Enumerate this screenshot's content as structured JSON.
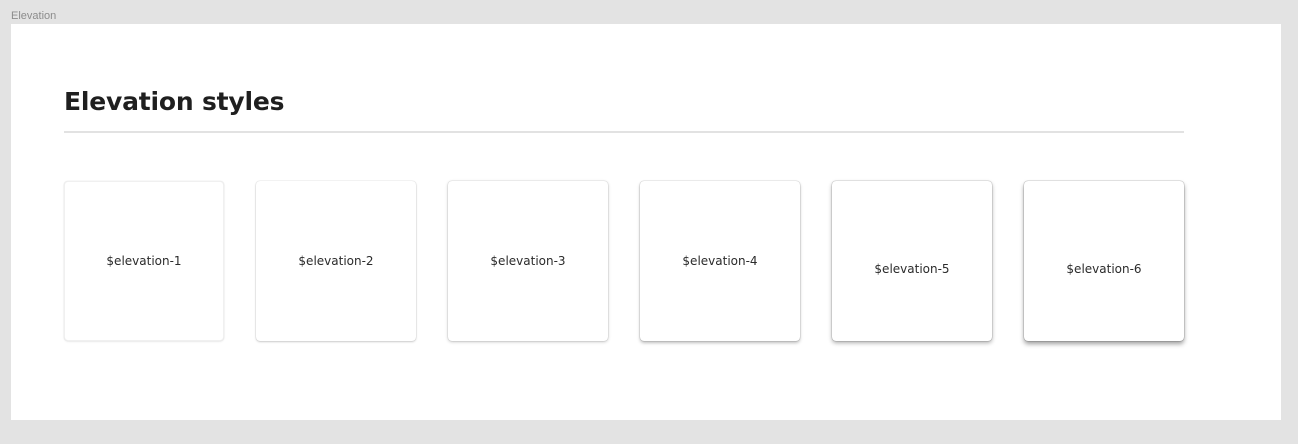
{
  "frame": {
    "label": "Elevation"
  },
  "section": {
    "title": "Elevation styles"
  },
  "cards": [
    {
      "label": "$elevation-1"
    },
    {
      "label": "$elevation-2"
    },
    {
      "label": "$elevation-3"
    },
    {
      "label": "$elevation-4"
    },
    {
      "label": "$elevation-5"
    },
    {
      "label": "$elevation-6"
    }
  ],
  "colors": {
    "canvas": "#e3e3e3",
    "frame": "#ffffff",
    "title": "#1f1f1f",
    "divider": "#e2e2e2"
  }
}
